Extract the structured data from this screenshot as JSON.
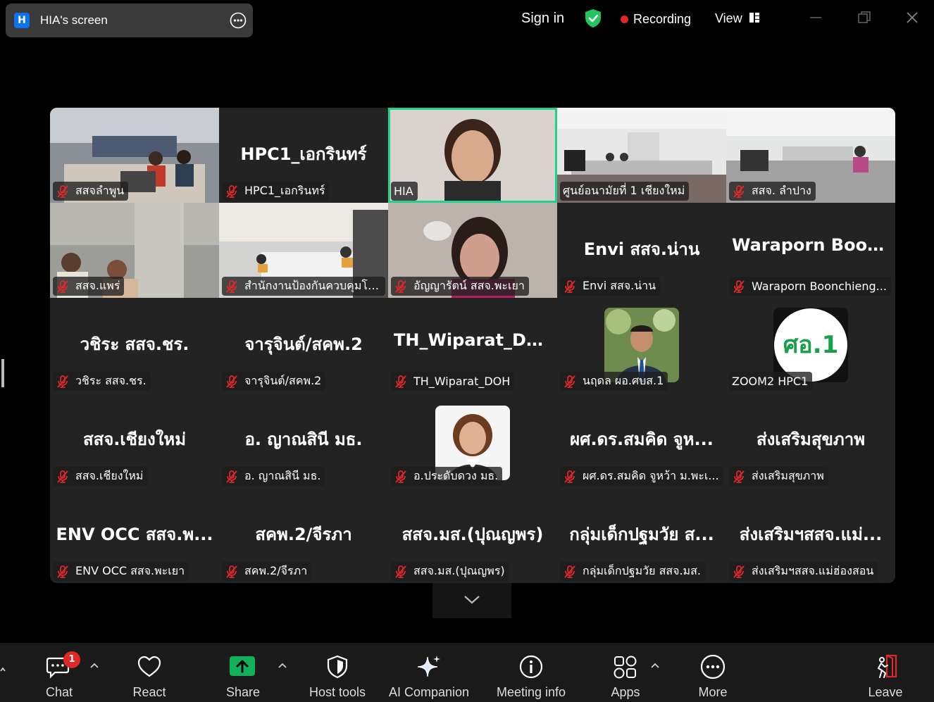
{
  "window": {
    "badge_letter": "H",
    "screen_title": "HIA's screen",
    "sign_in": "Sign in",
    "recording": "Recording",
    "view": "View",
    "colors": {
      "accent_green": "#23d18b",
      "record_red": "#e02828",
      "share_green": "#12b05a",
      "badge_blue": "#0e72ed"
    }
  },
  "participants": [
    {
      "name": "สสจลำพูน",
      "video": "room-a",
      "muted": true
    },
    {
      "name": "HPC1_เอกรินทร์",
      "big": "HPC1_เอกรินทร์",
      "muted": true
    },
    {
      "name": "HIA",
      "video": "face-hia",
      "muted": false,
      "active": true
    },
    {
      "name": "ศูนย์อนามัยที่ 1 เชียงใหม่",
      "video": "room-b",
      "muted": false
    },
    {
      "name": "สสจ. ลำปาง",
      "video": "room-c",
      "muted": true
    },
    {
      "name": "สสจ.แพร่",
      "video": "room-d",
      "muted": true
    },
    {
      "name": "สำนักงานป้องกันควบคุมโร...",
      "video": "room-e",
      "muted": true
    },
    {
      "name": "อัญญารัตน์ สสจ.พะเยา",
      "video": "face-blur",
      "muted": true
    },
    {
      "name": "Envi สสจ.น่าน",
      "big": "Envi สสจ.น่าน",
      "muted": true
    },
    {
      "name": "Waraporn Boonchieng...",
      "big": "Waraporn  Boon...",
      "muted": true
    },
    {
      "name": "วชิระ สสจ.ชร.",
      "big": "วชิระ สสจ.ชร.",
      "muted": true
    },
    {
      "name": "จารุจินต์/สคพ.2",
      "big": "จารุจินต์/สคพ.2",
      "muted": true
    },
    {
      "name": "TH_Wiparat_DOH",
      "big": "TH_Wiparat_DOH",
      "muted": true
    },
    {
      "name": "นฤดล ผอ.ศบส.1",
      "avatar": "man-suit",
      "muted": true
    },
    {
      "name": "ZOOM2 HPC1",
      "avatar": "logo",
      "logo_text": "ศอ.1",
      "muted": false
    },
    {
      "name": "สสจ.เชียงใหม่",
      "big": "สสจ.เชียงใหม่",
      "muted": true
    },
    {
      "name": "อ. ญาณสินี มธ.",
      "big": "อ. ญาณสินี มธ.",
      "muted": true
    },
    {
      "name": "อ.ประดับดวง มธ.",
      "avatar": "woman",
      "muted": true
    },
    {
      "name": "ผศ.ดร.สมคิด จูหว้า  ม.พะเ...",
      "big": "ผศ.ดร.สมคิด จูห...",
      "muted": true
    },
    {
      "name": "ส่งเสริมสุขภาพ",
      "big": "ส่งเสริมสุขภาพ",
      "muted": true
    },
    {
      "name": "ENV OCC สสจ.พะเยา",
      "big": "ENV  OCC สสจ.พ...",
      "muted": true
    },
    {
      "name": "สคพ.2/จีรภา",
      "big": "สคพ.2/จีรภา",
      "muted": true
    },
    {
      "name": "สสจ.มส.(ปุณญพร)",
      "big": "สสจ.มส.(ปุณญพร)",
      "muted": true
    },
    {
      "name": "กลุ่มเด็กปฐมวัย สสจ.มส.",
      "big": "กลุ่มเด็กปฐมวัย ส...",
      "muted": true
    },
    {
      "name": "ส่งเสริมฯสสจ.แม่ฮ่องสอน",
      "big": "ส่งเสริมฯสสจ.แม่...",
      "muted": true
    }
  ],
  "toolbar": {
    "chat": "Chat",
    "chat_badge": "1",
    "react": "React",
    "share": "Share",
    "host_tools": "Host tools",
    "ai_companion": "AI Companion",
    "meeting_info": "Meeting info",
    "apps": "Apps",
    "more": "More",
    "leave": "Leave"
  }
}
